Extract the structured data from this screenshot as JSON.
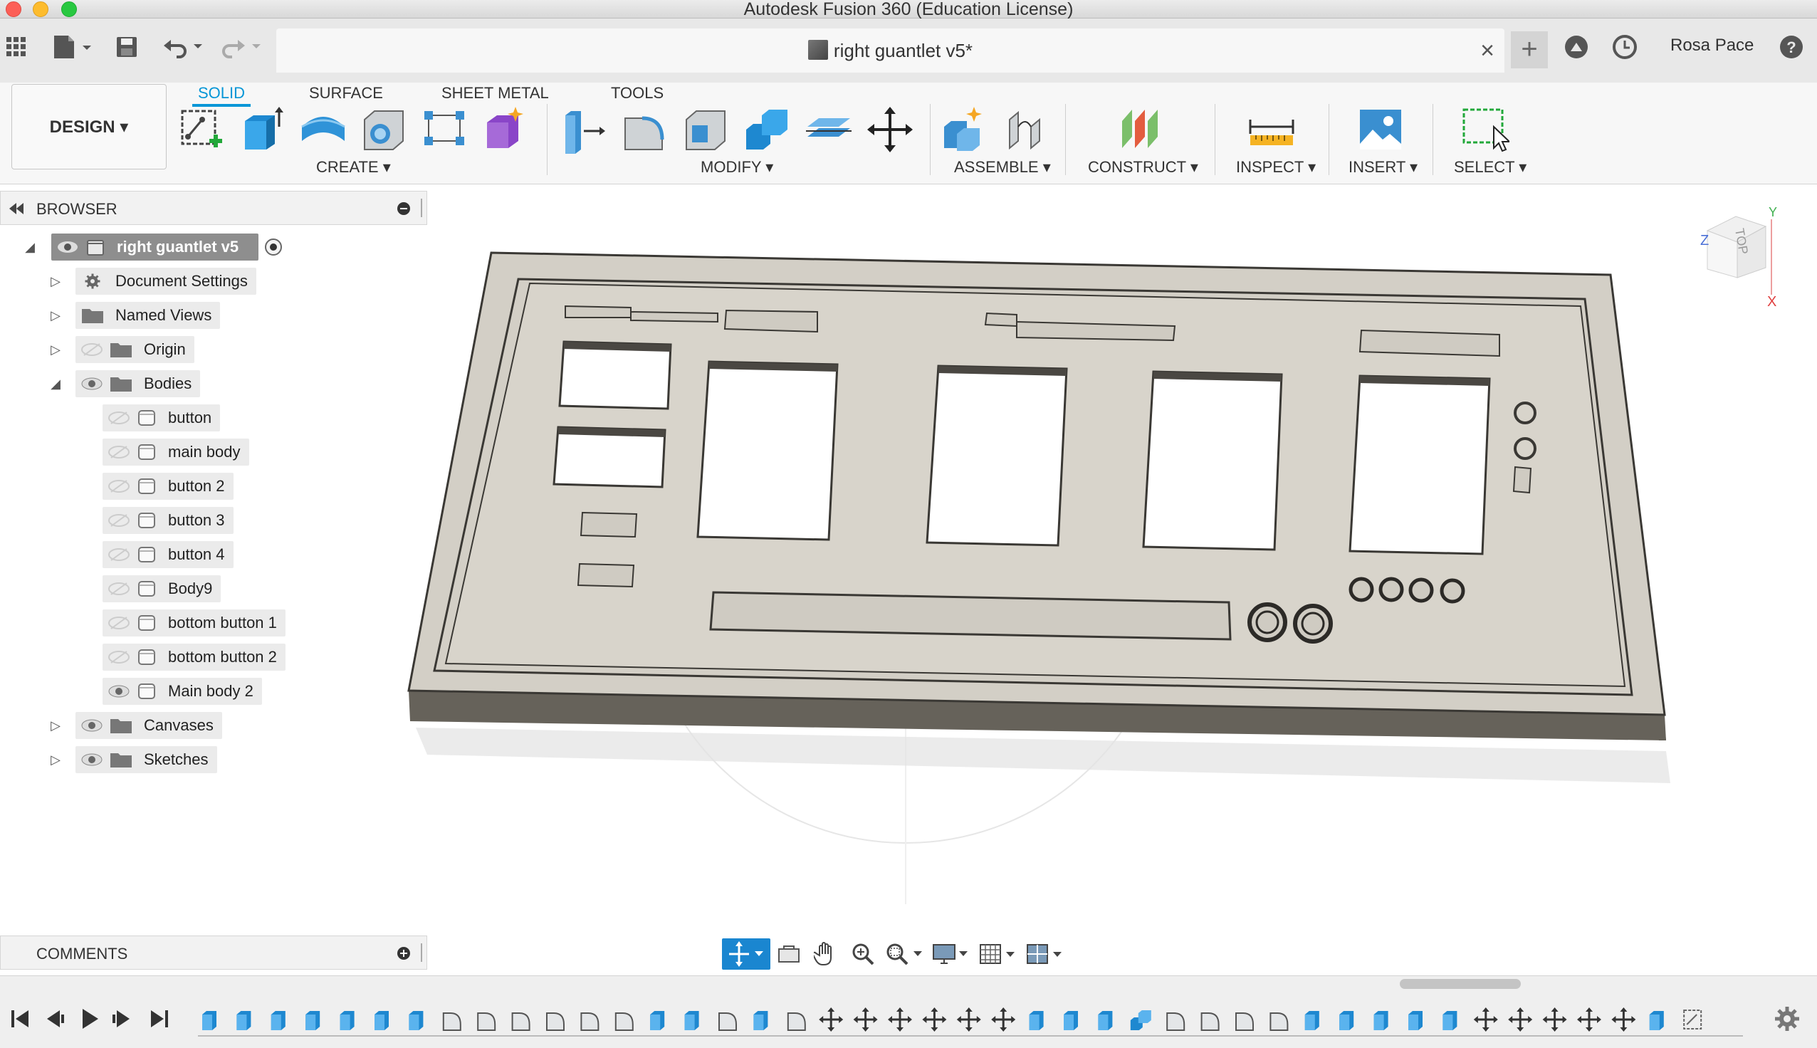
{
  "app": {
    "title": "Autodesk Fusion 360 (Education License)"
  },
  "document_tab": {
    "title": "right guantlet v5*"
  },
  "user": {
    "name": "Rosa Pace"
  },
  "workspace": {
    "label": "DESIGN ▾"
  },
  "ribbon": {
    "tabs": [
      "SOLID",
      "SURFACE",
      "SHEET METAL",
      "TOOLS"
    ],
    "active_tab": "SOLID",
    "groups": {
      "create": "CREATE ▾",
      "modify": "MODIFY ▾",
      "assemble": "ASSEMBLE ▾",
      "construct": "CONSTRUCT ▾",
      "inspect": "INSPECT ▾",
      "insert": "INSERT ▾",
      "select": "SELECT ▾"
    }
  },
  "browser": {
    "title": "BROWSER",
    "root": "right guantlet v5",
    "items": {
      "document_settings": "Document Settings",
      "named_views": "Named Views",
      "origin": "Origin",
      "bodies": "Bodies",
      "canvases": "Canvases",
      "sketches": "Sketches"
    },
    "bodies": [
      "button",
      "main body",
      "button 2",
      "button 3",
      "button 4",
      "Body9",
      "bottom button 1",
      "bottom button 2",
      "Main body 2"
    ]
  },
  "comments": {
    "title": "COMMENTS"
  },
  "viewcube": {
    "face": "TOP",
    "axis_z": "Z",
    "axis_x": "X",
    "axis_y": "Y"
  },
  "colors": {
    "accent": "#0696d7",
    "body_top": "#d4d0c8",
    "body_side": "#6f6b63"
  },
  "timeline": {
    "feature_sequence": [
      "extrude",
      "extrude",
      "extrude",
      "extrude",
      "extrude",
      "extrude",
      "extrude",
      "fillet",
      "fillet",
      "fillet",
      "fillet",
      "fillet",
      "fillet",
      "extrude",
      "extrude",
      "fillet",
      "extrude",
      "fillet",
      "move",
      "move",
      "move",
      "move",
      "move",
      "move",
      "extrude",
      "extrude",
      "extrude",
      "combine",
      "fillet",
      "fillet",
      "fillet",
      "fillet",
      "extrude",
      "extrude",
      "extrude",
      "extrude",
      "extrude",
      "move",
      "move",
      "move",
      "move",
      "move",
      "extrude",
      "sketch"
    ]
  }
}
